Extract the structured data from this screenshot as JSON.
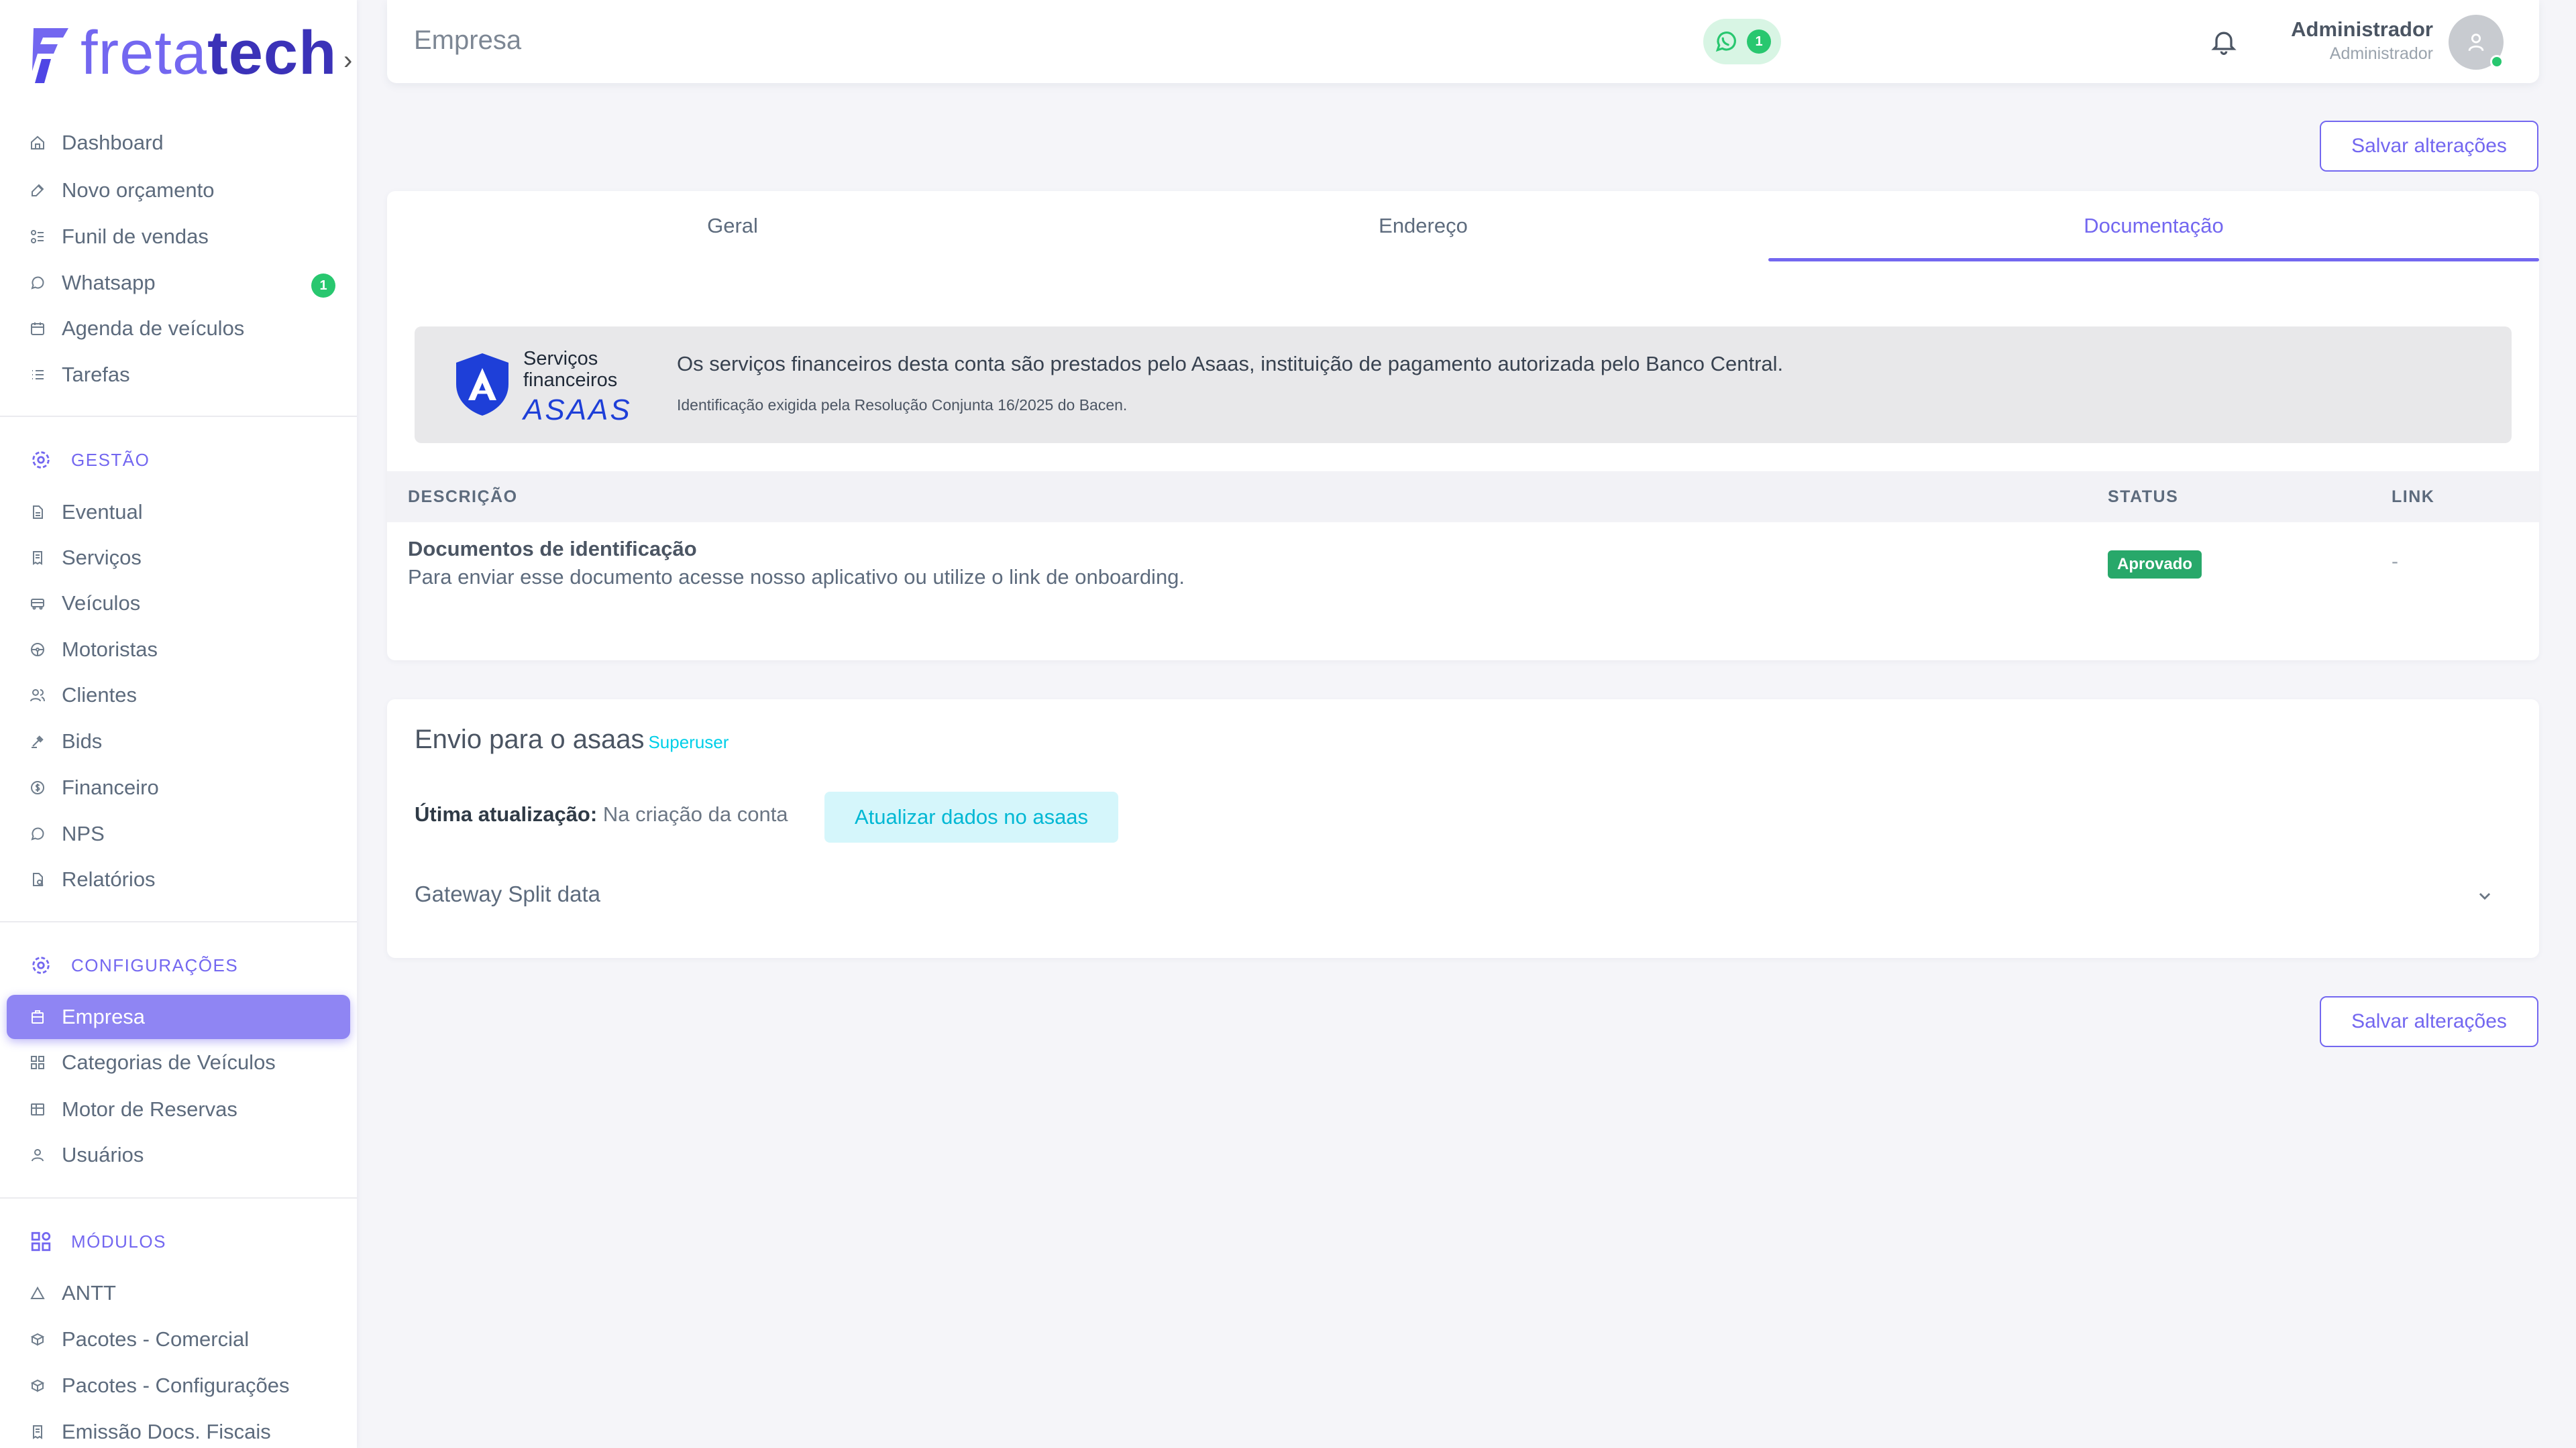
{
  "brand": {
    "name_part1": "freta",
    "name_part2": "tech",
    "caret": "›"
  },
  "sidebar": {
    "main_items": [
      {
        "label": "Dashboard",
        "icon": "home-icon"
      },
      {
        "label": "Novo orçamento",
        "icon": "edit-icon"
      },
      {
        "label": "Funil de vendas",
        "icon": "filter-icon"
      },
      {
        "label": "Whatsapp",
        "icon": "whatsapp-icon",
        "badge": "1"
      },
      {
        "label": "Agenda de veículos",
        "icon": "calendar-icon"
      },
      {
        "label": "Tarefas",
        "icon": "list-icon"
      }
    ],
    "gestao": {
      "title": "GESTÃO",
      "items": [
        {
          "label": "Eventual"
        },
        {
          "label": "Serviços"
        },
        {
          "label": "Veículos"
        },
        {
          "label": "Motoristas"
        },
        {
          "label": "Clientes"
        },
        {
          "label": "Bids"
        },
        {
          "label": "Financeiro"
        },
        {
          "label": "NPS"
        },
        {
          "label": "Relatórios"
        }
      ]
    },
    "configuracoes": {
      "title": "CONFIGURAÇÕES",
      "items": [
        {
          "label": "Empresa",
          "active": true
        },
        {
          "label": "Categorias de Veículos"
        },
        {
          "label": "Motor de Reservas"
        },
        {
          "label": "Usuários"
        }
      ]
    },
    "modulos": {
      "title": "MÓDULOS",
      "items": [
        {
          "label": "ANTT"
        },
        {
          "label": "Pacotes - Comercial"
        },
        {
          "label": "Pacotes - Configurações"
        },
        {
          "label": "Emissão Docs. Fiscais"
        }
      ]
    }
  },
  "topbar": {
    "title": "Empresa",
    "whatsapp_count": "1",
    "user_name": "Administrador",
    "user_role": "Administrador"
  },
  "actions": {
    "save_label": "Salvar alterações"
  },
  "tabs": [
    {
      "label": "Geral"
    },
    {
      "label": "Endereço"
    },
    {
      "label": "Documentação",
      "active": true
    }
  ],
  "asaas": {
    "label_line1": "Serviços",
    "label_line2": "financeiros",
    "logo_text": "ASAAS",
    "main_text": "Os serviços financeiros desta conta são prestados pelo Asaas, instituição de pagamento autorizada pelo Banco Central.",
    "sub_text": "Identificação exigida pela Resolução Conjunta 16/2025 do Bacen."
  },
  "documents": {
    "headers": {
      "description": "DESCRIÇÃO",
      "status": "STATUS",
      "link": "LINK"
    },
    "rows": [
      {
        "title": "Documentos de identificação",
        "description": "Para enviar esse documento acesse nosso aplicativo ou utilize o link de onboarding.",
        "status": "Aprovado",
        "link": "-"
      }
    ]
  },
  "envio": {
    "title": "Envio para o asaas",
    "tag": "Superuser",
    "last_update_label": "Útima atualização:",
    "last_update_value": "Na criação da conta",
    "update_button": "Atualizar dados no asaas",
    "gateway_label": "Gateway Split data"
  },
  "colors": {
    "accent": "#7367f0",
    "success": "#28c76f",
    "info": "#00cfe8",
    "asaas_blue": "#1e3fd8"
  }
}
